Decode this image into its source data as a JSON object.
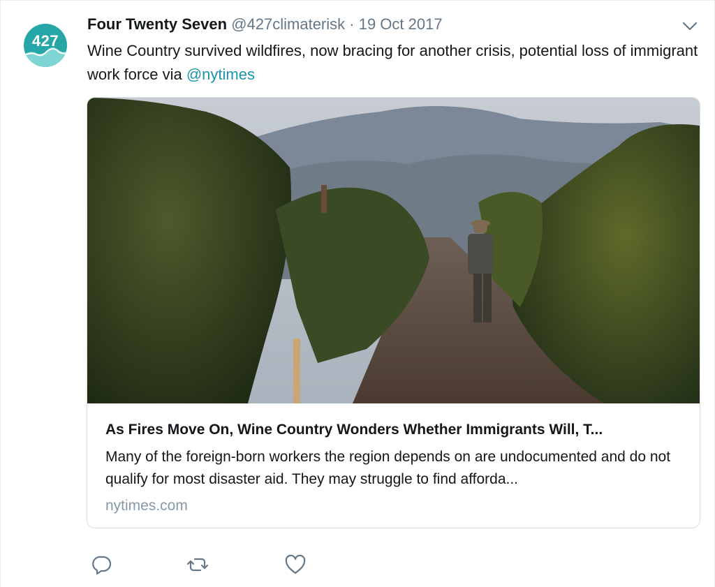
{
  "tweet": {
    "avatar_text": "427",
    "author_name": "Four Twenty Seven",
    "author_handle": "@427climaterisk",
    "separator": "·",
    "date": "19 Oct 2017",
    "text_before_mention": "Wine Country survived wildfires, now bracing for another crisis, potential loss of immigrant work force via ",
    "mention": "@nytimes"
  },
  "card": {
    "title": "As Fires Move On, Wine Country Wonders Whether Immigrants Will, T...",
    "description": "Many of the foreign-born workers the region depends on are undocumented and do not qualify for most disaster aid. They may struggle to find afforda...",
    "domain": "nytimes.com"
  },
  "icons": {
    "menu": "chevron-down-icon",
    "reply": "reply-icon",
    "retweet": "retweet-icon",
    "like": "heart-icon"
  },
  "colors": {
    "accent": "#1b95a8",
    "avatar_bg": "#27a6a8",
    "secondary_text": "#657786",
    "domain_text": "#8899a6"
  }
}
